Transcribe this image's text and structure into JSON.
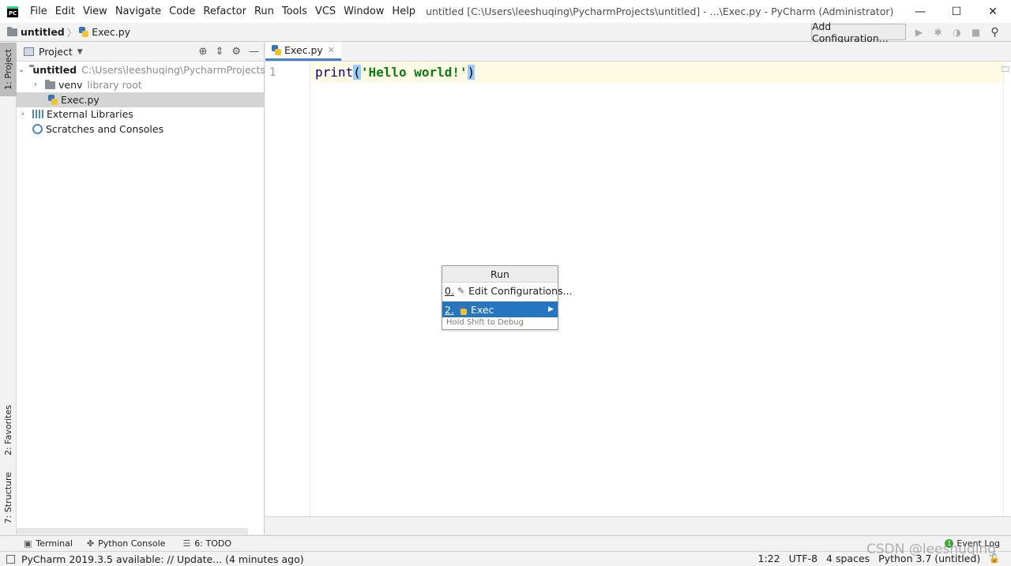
{
  "window": {
    "title": "untitled [C:\\Users\\leeshuqing\\PycharmProjects\\untitled] - ...\\Exec.py - PyCharm (Administrator)",
    "logo_text": "PC",
    "minimize": "—",
    "maximize": "☐",
    "close": "✕"
  },
  "menu": [
    "File",
    "Edit",
    "View",
    "Navigate",
    "Code",
    "Refactor",
    "Run",
    "Tools",
    "VCS",
    "Window",
    "Help"
  ],
  "navbar": {
    "project": "untitled",
    "separator": "〉",
    "file": "Exec.py",
    "add_configuration": "Add Configuration..."
  },
  "left_strip": {
    "project_tab": "1: Project",
    "favorites_tab": "2: Favorites",
    "structure_tab": "7: Structure"
  },
  "project_panel": {
    "title": "Project",
    "tree": {
      "root_name": "untitled",
      "root_path": "C:\\Users\\leeshuqing\\PycharmProjects\\untitled",
      "venv_name": "venv",
      "venv_hint": "library root",
      "file_name": "Exec.py",
      "external_libraries": "External Libraries",
      "scratches": "Scratches and Consoles"
    }
  },
  "editor": {
    "tab_label": "Exec.py",
    "line_number": "1",
    "code": {
      "fn": "print",
      "open": "(",
      "str": "'Hello world!'",
      "close": ")"
    }
  },
  "run_popup": {
    "title": "Run",
    "items": [
      {
        "mnemonic": "0.",
        "label": "Edit Configurations..."
      },
      {
        "mnemonic": "2.",
        "label": "Exec"
      }
    ],
    "hint": "Hold Shift to Debug"
  },
  "tool_strip": {
    "terminal": "Terminal",
    "python_console": "Python Console",
    "todo": "6: TODO",
    "event_log": "Event Log",
    "event_count": "1"
  },
  "status": {
    "message": "PyCharm 2019.3.5 available: // Update... (4 minutes ago)",
    "position": "1:22",
    "encoding": "UTF-8",
    "indent": "4 spaces",
    "interpreter": "Python 3.7 (untitled)"
  },
  "watermark": "CSDN @leeshuqing",
  "colors": {
    "accent": "#2675bf",
    "string": "#067d17",
    "keyword": "#000080",
    "current_line": "#fffae3"
  }
}
